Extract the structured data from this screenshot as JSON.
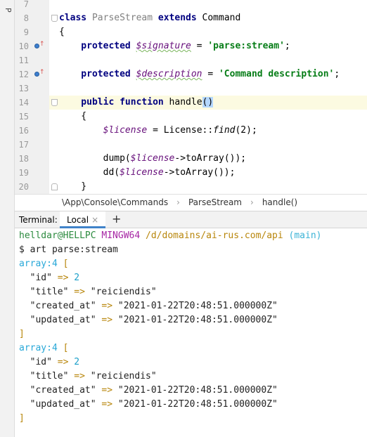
{
  "side_tab": "P",
  "editor": {
    "lines": [
      {
        "num": "7",
        "parts": []
      },
      {
        "num": "8",
        "parts": [
          {
            "t": "class",
            "c": "kw"
          },
          {
            "t": " ",
            "c": ""
          },
          {
            "t": "ParseStream",
            "c": "dimcls"
          },
          {
            "t": " ",
            "c": ""
          },
          {
            "t": "extends",
            "c": "kw"
          },
          {
            "t": " Command",
            "c": ""
          }
        ],
        "fold": "down"
      },
      {
        "num": "9",
        "parts": [
          {
            "t": "{",
            "c": ""
          }
        ]
      },
      {
        "num": "10",
        "marker": true,
        "parts": [
          {
            "t": "    protected",
            "c": "kw"
          },
          {
            "t": " ",
            "c": ""
          },
          {
            "t": "$signature",
            "c": "var squig"
          },
          {
            "t": " = ",
            "c": ""
          },
          {
            "t": "'parse:stream'",
            "c": "str"
          },
          {
            "t": ";",
            "c": ""
          }
        ]
      },
      {
        "num": "11",
        "parts": []
      },
      {
        "num": "12",
        "marker": true,
        "parts": [
          {
            "t": "    protected",
            "c": "kw"
          },
          {
            "t": " ",
            "c": ""
          },
          {
            "t": "$description",
            "c": "var squig"
          },
          {
            "t": " = ",
            "c": ""
          },
          {
            "t": "'Command description'",
            "c": "str"
          },
          {
            "t": ";",
            "c": ""
          }
        ]
      },
      {
        "num": "13",
        "parts": []
      },
      {
        "num": "14",
        "current": true,
        "fold": "down",
        "parts": [
          {
            "t": "    public",
            "c": "kw"
          },
          {
            "t": " ",
            "c": ""
          },
          {
            "t": "function",
            "c": "kw"
          },
          {
            "t": " handle",
            "c": ""
          },
          {
            "t": "()",
            "c": "match"
          }
        ]
      },
      {
        "num": "15",
        "parts": [
          {
            "t": "    {",
            "c": ""
          }
        ]
      },
      {
        "num": "16",
        "parts": [
          {
            "t": "        ",
            "c": ""
          },
          {
            "t": "$license",
            "c": "var"
          },
          {
            "t": " = License::",
            "c": ""
          },
          {
            "t": "find",
            "c": "fnital"
          },
          {
            "t": "(2);",
            "c": ""
          }
        ]
      },
      {
        "num": "17",
        "parts": []
      },
      {
        "num": "18",
        "parts": [
          {
            "t": "        dump(",
            "c": ""
          },
          {
            "t": "$license",
            "c": "var"
          },
          {
            "t": "->toArray());",
            "c": ""
          }
        ]
      },
      {
        "num": "19",
        "parts": [
          {
            "t": "        dd(",
            "c": ""
          },
          {
            "t": "$license",
            "c": "var"
          },
          {
            "t": "->toArray());",
            "c": ""
          }
        ]
      },
      {
        "num": "20",
        "fold": "up",
        "parts": [
          {
            "t": "    }",
            "c": ""
          }
        ]
      }
    ]
  },
  "breadcrumb": {
    "items": [
      "\\App\\Console\\Commands",
      "ParseStream",
      "handle()"
    ],
    "separator": "›"
  },
  "terminal": {
    "title": "Terminal:",
    "tab_label": "Local",
    "tab_close": "×",
    "add_label": "+",
    "lines": [
      [
        {
          "t": "helldar@HELLPC",
          "c": "t-green"
        },
        {
          "t": " ",
          "c": ""
        },
        {
          "t": "MINGW64",
          "c": "t-purple"
        },
        {
          "t": " ",
          "c": ""
        },
        {
          "t": "/d/domains/ai-rus.com/api",
          "c": "t-gold"
        },
        {
          "t": " ",
          "c": ""
        },
        {
          "t": "(main)",
          "c": "t-cyan"
        }
      ],
      [
        {
          "t": "$ art parse:stream",
          "c": "t-dark"
        }
      ],
      [
        {
          "t": "array:4",
          "c": "t-blue"
        },
        {
          "t": " [",
          "c": "t-gold"
        }
      ],
      [
        {
          "t": "  \"id\"",
          "c": "t-dark"
        },
        {
          "t": " => ",
          "c": "t-gold"
        },
        {
          "t": "2",
          "c": "t-num"
        }
      ],
      [
        {
          "t": "  \"title\"",
          "c": "t-dark"
        },
        {
          "t": " => ",
          "c": "t-gold"
        },
        {
          "t": "\"reiciendis\"",
          "c": "t-dark"
        }
      ],
      [
        {
          "t": "  \"created_at\"",
          "c": "t-dark"
        },
        {
          "t": " => ",
          "c": "t-gold"
        },
        {
          "t": "\"2021-01-22T20:48:51.000000Z\"",
          "c": "t-dark"
        }
      ],
      [
        {
          "t": "  \"updated_at\"",
          "c": "t-dark"
        },
        {
          "t": " => ",
          "c": "t-gold"
        },
        {
          "t": "\"2021-01-22T20:48:51.000000Z\"",
          "c": "t-dark"
        }
      ],
      [
        {
          "t": "]",
          "c": "t-gold"
        }
      ],
      [
        {
          "t": "array:4",
          "c": "t-blue"
        },
        {
          "t": " [",
          "c": "t-gold"
        }
      ],
      [
        {
          "t": "  \"id\"",
          "c": "t-dark"
        },
        {
          "t": " => ",
          "c": "t-gold"
        },
        {
          "t": "2",
          "c": "t-num"
        }
      ],
      [
        {
          "t": "  \"title\"",
          "c": "t-dark"
        },
        {
          "t": " => ",
          "c": "t-gold"
        },
        {
          "t": "\"reiciendis\"",
          "c": "t-dark"
        }
      ],
      [
        {
          "t": "  \"created_at\"",
          "c": "t-dark"
        },
        {
          "t": " => ",
          "c": "t-gold"
        },
        {
          "t": "\"2021-01-22T20:48:51.000000Z\"",
          "c": "t-dark"
        }
      ],
      [
        {
          "t": "  \"updated_at\"",
          "c": "t-dark"
        },
        {
          "t": " => ",
          "c": "t-gold"
        },
        {
          "t": "\"2021-01-22T20:48:51.000000Z\"",
          "c": "t-dark"
        }
      ],
      [
        {
          "t": "]",
          "c": "t-gold"
        }
      ]
    ]
  },
  "colors": {
    "keyword": "#000080",
    "string": "#067d17",
    "variable": "#660e7a",
    "current_line": "#fcfae1",
    "tab_underline": "#4083c9"
  }
}
